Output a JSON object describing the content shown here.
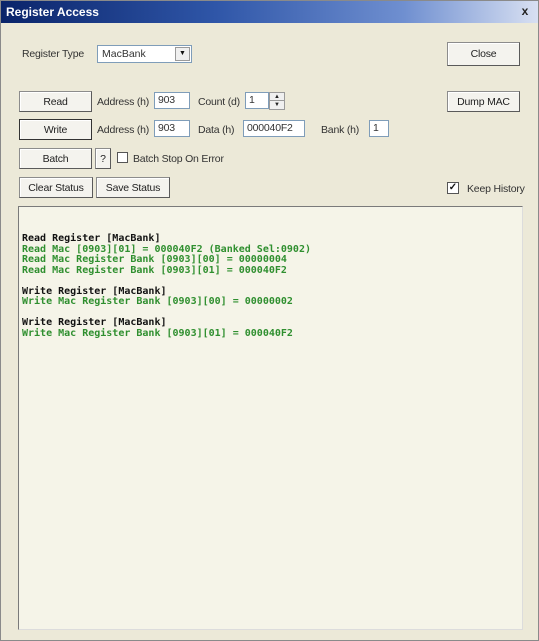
{
  "window": {
    "title": "Register Access",
    "close_glyph": "x"
  },
  "register_type": {
    "label": "Register Type",
    "value": "MacBank"
  },
  "buttons": {
    "close": "Close",
    "dump_mac": "Dump MAC",
    "read": "Read",
    "write": "Write",
    "batch": "Batch",
    "help": "?",
    "clear_status": "Clear Status",
    "save_status": "Save Status"
  },
  "read_row": {
    "address_label": "Address (h)",
    "address_value": "903",
    "count_label": "Count (d)",
    "count_value": "1"
  },
  "write_row": {
    "address_label": "Address (h)",
    "address_value": "903",
    "data_label": "Data (h)",
    "data_value": "000040F2",
    "bank_label": "Bank (h)",
    "bank_value": "1"
  },
  "batch_stop": {
    "label": "Batch Stop On Error",
    "checked": false
  },
  "keep_history": {
    "label": "Keep History",
    "checked": true,
    "check_glyph": "✓"
  },
  "status_log": [
    {
      "type": "head",
      "text": "Read Register [MacBank]"
    },
    {
      "type": "green",
      "text": "Read Mac [0903][01] = 000040F2 (Banked Sel:0902)"
    },
    {
      "type": "green",
      "text": "Read Mac Register Bank [0903][00] = 00000004"
    },
    {
      "type": "green",
      "text": "Read Mac Register Bank [0903][01] = 000040F2"
    },
    {
      "type": "gap",
      "text": ""
    },
    {
      "type": "head",
      "text": "Write Register [MacBank]"
    },
    {
      "type": "green",
      "text": "Write Mac Register Bank [0903][00] = 00000002"
    },
    {
      "type": "gap",
      "text": ""
    },
    {
      "type": "head",
      "text": "Write Register [MacBank]"
    },
    {
      "type": "green",
      "text": "Write Mac Register Bank [0903][01] = 000040F2"
    }
  ],
  "colors": {
    "log_green": "#2f8f2f",
    "title_bar": "#0a246a"
  }
}
